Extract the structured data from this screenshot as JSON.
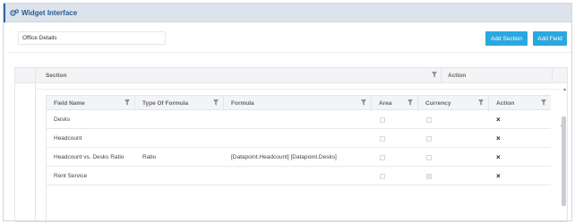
{
  "header": {
    "title": "Widget Interface"
  },
  "office_field": {
    "value": "Office Details"
  },
  "buttons": {
    "add_section": "Add Section",
    "add_field": "Add Field"
  },
  "outer_grid": {
    "columns": [
      "Section",
      "Action"
    ]
  },
  "fields_grid": {
    "columns": [
      "Field Name",
      "Type Of Formula",
      "Formula",
      "Area",
      "Currency",
      "Action"
    ],
    "rows": [
      {
        "field_name": "Desks",
        "type_of_formula": "",
        "formula": "",
        "area": false,
        "currency": false,
        "action": "×"
      },
      {
        "field_name": "Headcount",
        "type_of_formula": "",
        "formula": "",
        "area": false,
        "currency": false,
        "action": "×"
      },
      {
        "field_name": "Headcount vs. Desks Ratio",
        "type_of_formula": "Ratio",
        "formula": "[Datapoint.Headcount] [Datapoint.Desks]",
        "area": false,
        "currency": false,
        "action": "×"
      },
      {
        "field_name": "Rent Service",
        "type_of_formula": "",
        "formula": "",
        "area": false,
        "currency": true,
        "action": "×"
      }
    ]
  },
  "colors": {
    "accent": "#2e64a8",
    "button": "#2aa8df",
    "header_bg": "#dde3ec"
  }
}
